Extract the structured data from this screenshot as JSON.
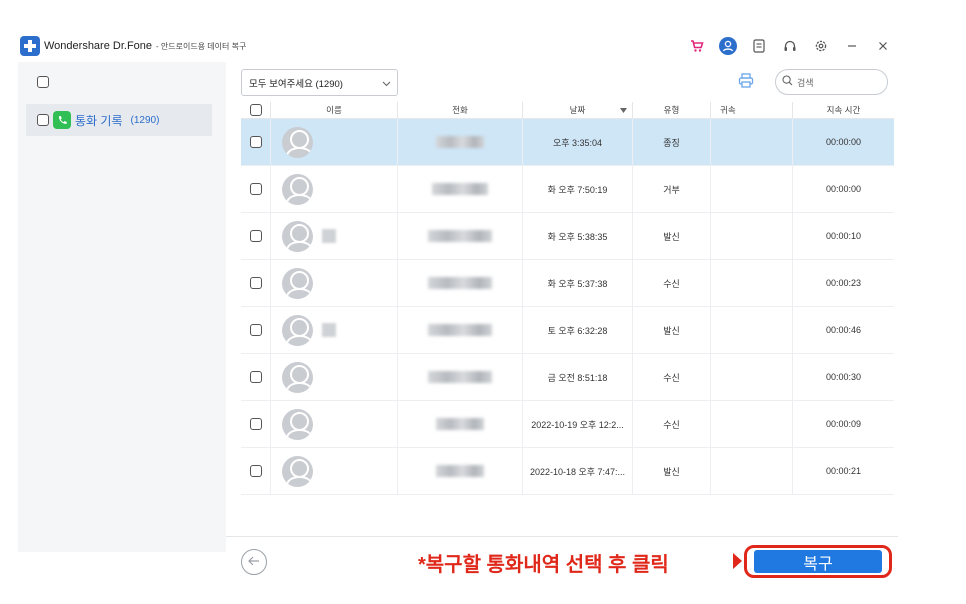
{
  "window": {
    "title": "Wondershare Dr.Fone",
    "subtitle": "- 안드로이드용 데이터 복구"
  },
  "sidebar": {
    "items": [
      {
        "label": "통화 기록",
        "count": "(1290)"
      }
    ]
  },
  "toolbar": {
    "filter_value": "모두 보여주세요 (1290)",
    "search_placeholder": "검색"
  },
  "table": {
    "headers": [
      "이름",
      "전화",
      "날짜",
      "유형",
      "귀속",
      "지속 시간"
    ],
    "rows": [
      {
        "date": "오후 3:35:04",
        "type": "종징",
        "attribution": "",
        "duration": "00:00:00",
        "selected": true
      },
      {
        "date": "화 오후 7:50:19",
        "type": "거부",
        "attribution": "",
        "duration": "00:00:00",
        "selected": false
      },
      {
        "date": "화 오후 5:38:35",
        "type": "발신",
        "attribution": "",
        "duration": "00:00:10",
        "selected": false
      },
      {
        "date": "화 오후 5:37:38",
        "type": "수신",
        "attribution": "",
        "duration": "00:00:23",
        "selected": false
      },
      {
        "date": "토 오후 6:32:28",
        "type": "발신",
        "attribution": "",
        "duration": "00:00:46",
        "selected": false
      },
      {
        "date": "금 오전 8:51:18",
        "type": "수신",
        "attribution": "",
        "duration": "00:00:30",
        "selected": false
      },
      {
        "date": "2022-10-19 오후 12:2...",
        "type": "수신",
        "attribution": "",
        "duration": "00:00:09",
        "selected": false
      },
      {
        "date": "2022-10-18 오후 7:47:...",
        "type": "발신",
        "attribution": "",
        "duration": "00:00:21",
        "selected": false
      }
    ]
  },
  "footer": {
    "instruction": "*복구할 통화내역 선택 후 클릭",
    "restore_label": "복구"
  },
  "colors": {
    "accent": "#1f79e0",
    "annotation": "#e0281a",
    "selected_row": "#cfe6f7",
    "call_log_icon": "#2fbf55"
  },
  "icons": [
    "app-logo-icon",
    "cart-icon",
    "account-icon",
    "notes-icon",
    "headset-icon",
    "gear-icon",
    "minimize-icon",
    "close-icon",
    "phone-icon",
    "chevron-down-icon",
    "printer-icon",
    "search-icon",
    "sort-down-icon",
    "back-arrow-icon"
  ]
}
